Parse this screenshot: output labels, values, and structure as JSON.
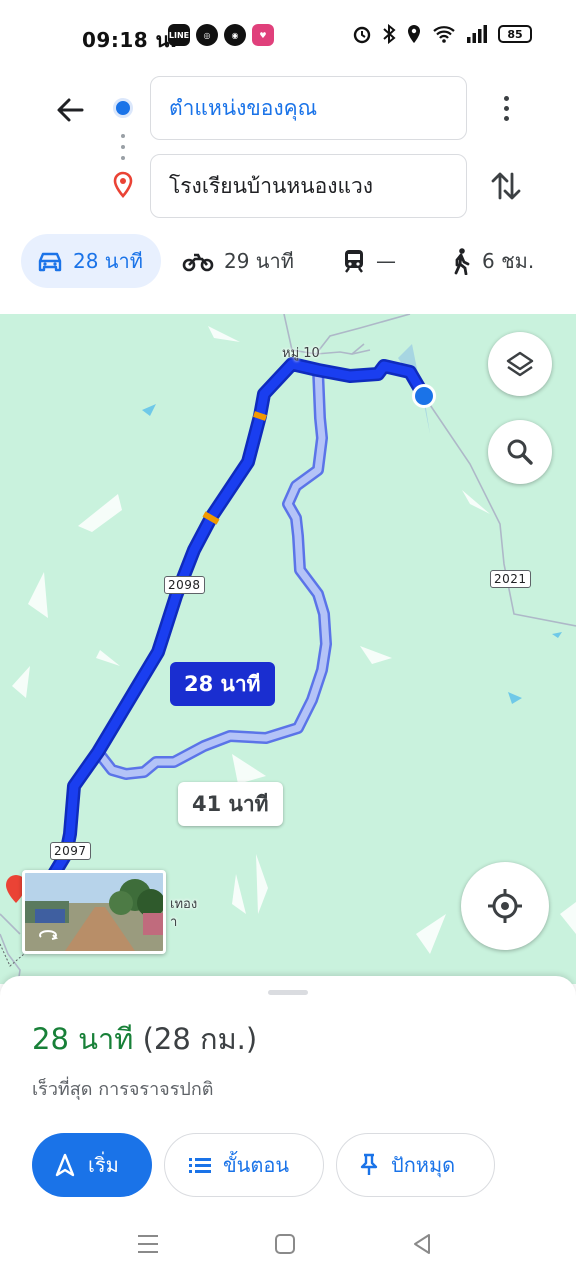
{
  "status_bar": {
    "time": "09:18 น.",
    "apps": [
      "LINE",
      "app-2",
      "chrome",
      "app-4"
    ],
    "battery": "85"
  },
  "directions": {
    "origin": "ตำแหน่งของคุณ",
    "destination": "โรงเรียนบ้านหนองแวง"
  },
  "modes": {
    "drive": {
      "label": "28 นาที",
      "icon": "car-icon",
      "active": true
    },
    "motorcycle": {
      "label": "29 นาที",
      "icon": "motorcycle-icon"
    },
    "transit": {
      "label": "—",
      "icon": "train-icon"
    },
    "walk": {
      "label": "6 ชม.",
      "icon": "walk-icon"
    }
  },
  "map": {
    "place_label": "หมู่ 10",
    "road_shields": [
      "2098",
      "2021",
      "2097"
    ],
    "partial_label": "เทอง\nา",
    "primary_route_time": "28 นาที",
    "alt_route_time": "41 นาที",
    "colors": {
      "primary_route": "#1a3ef0",
      "alt_route": "#a8b8f5",
      "traffic": "#f29900",
      "land": "#c9f2dd"
    }
  },
  "sheet": {
    "duration": "28 นาที",
    "distance": "(28 กม.)",
    "subtitle": "เร็วที่สุด การจราจรปกติ",
    "start_label": "เริ่ม",
    "steps_label": "ขั้นตอน",
    "pin_label": "ปักหมุด"
  }
}
